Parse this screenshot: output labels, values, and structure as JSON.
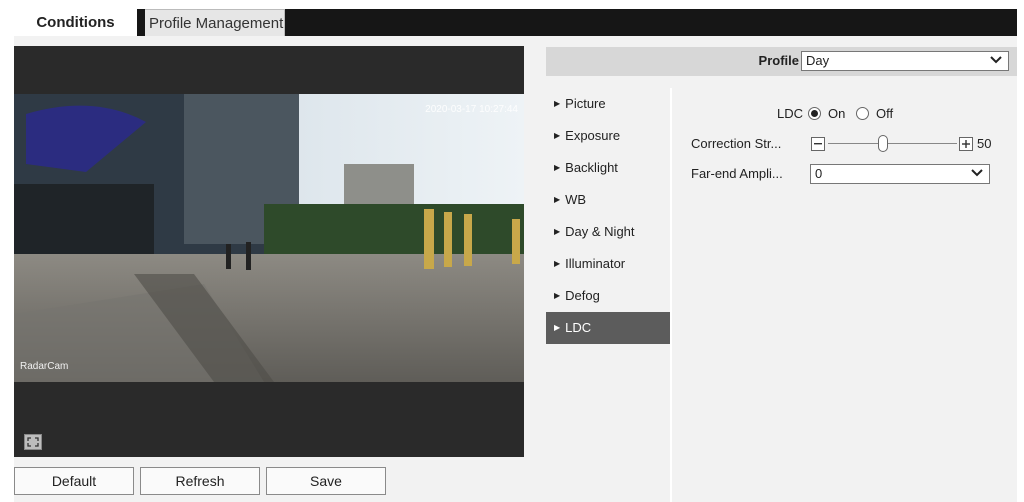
{
  "tabs": [
    {
      "label": "Conditions",
      "active": true
    },
    {
      "label": "Profile Management",
      "active": false
    }
  ],
  "video": {
    "overlay_datetime": "2020-03-17 10:27:44",
    "overlay_channel": "RadarCam"
  },
  "buttons": {
    "default": "Default",
    "refresh": "Refresh",
    "save": "Save"
  },
  "profile": {
    "label": "Profile",
    "value": "Day"
  },
  "menu": {
    "items": [
      {
        "label": "Picture",
        "active": false
      },
      {
        "label": "Exposure",
        "active": false
      },
      {
        "label": "Backlight",
        "active": false
      },
      {
        "label": "WB",
        "active": false
      },
      {
        "label": "Day & Night",
        "active": false
      },
      {
        "label": "Illuminator",
        "active": false
      },
      {
        "label": "Defog",
        "active": false
      },
      {
        "label": "LDC",
        "active": true
      }
    ]
  },
  "ldc": {
    "label": "LDC",
    "on_label": "On",
    "off_label": "Off",
    "selected": "On",
    "correction_label": "Correction Str...",
    "correction_value": "50",
    "far_end_label": "Far-end Ampli...",
    "far_end_value": "0"
  },
  "colors": {
    "tab_bar": "#161616",
    "panel_bg": "#f2f2f2",
    "active_menu": "#5c5c5c",
    "header_bg": "#d7d7d7"
  }
}
